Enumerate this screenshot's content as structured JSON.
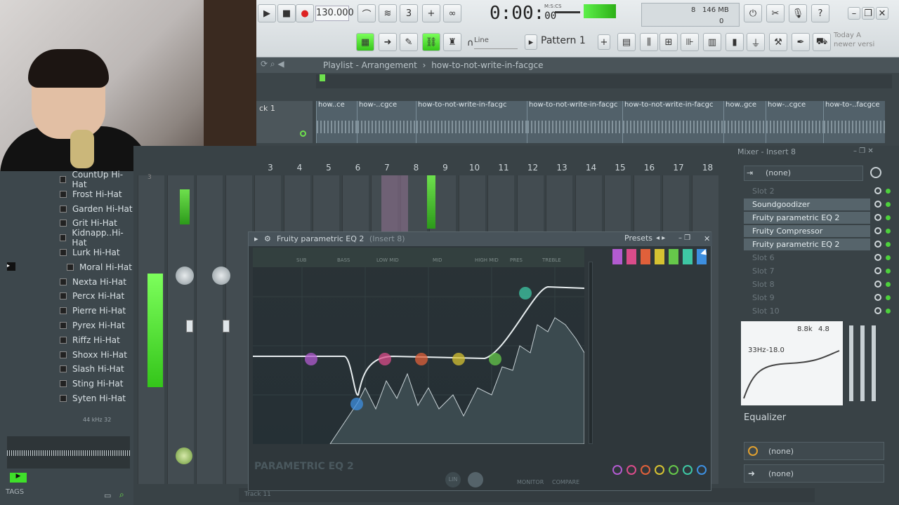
{
  "webcam": {},
  "toolbar": {
    "tempo": "130.000",
    "time_main": "0:00",
    "time_sub": "00",
    "time_unit": "M:S:CS",
    "mem": "146 MB",
    "cpu_num": "8",
    "cpu_zero": "0",
    "line_label": "Line",
    "pattern_label": "Pattern 1",
    "hint_line1": "Today  A",
    "hint_line2": "newer versi"
  },
  "playlist": {
    "title": "Playlist - Arrangement",
    "breadcrumb_sep": "›",
    "project": "how-to-not-write-in-facgce",
    "track_name": "ck 1",
    "clips": [
      {
        "label": "how..ce"
      },
      {
        "label": "how-..cgce"
      },
      {
        "label": "how-to-not-write-in-facgc"
      },
      {
        "label": "how-to-not-write-in-facgc"
      },
      {
        "label": "how-to-not-write-in-facgc"
      },
      {
        "label": "how..gce"
      },
      {
        "label": "how-..cgce"
      },
      {
        "label": "how-to-..facgce"
      }
    ]
  },
  "browser": {
    "items": [
      {
        "label": "CountUp Hi-Hat"
      },
      {
        "label": "Frost Hi-Hat"
      },
      {
        "label": "Garden Hi-Hat"
      },
      {
        "label": "Grit Hi-Hat"
      },
      {
        "label": "Kidnapp..Hi-Hat"
      },
      {
        "label": "Lurk Hi-Hat"
      },
      {
        "label": "Moral Hi-Hat"
      },
      {
        "label": "Nexta Hi-Hat"
      },
      {
        "label": "Percx Hi-Hat"
      },
      {
        "label": "Pierre Hi-Hat"
      },
      {
        "label": "Pyrex Hi-Hat"
      },
      {
        "label": "Riffz Hi-Hat"
      },
      {
        "label": "Shoxx Hi-Hat"
      },
      {
        "label": "Slash Hi-Hat"
      },
      {
        "label": "Sting Hi-Hat"
      },
      {
        "label": "Syten Hi-Hat"
      }
    ],
    "sample_info": "44 kHz 32",
    "tags_label": "TAGS"
  },
  "mixer": {
    "title": "Mixer - Insert 8",
    "insert_numbers": [
      "3",
      "4",
      "5",
      "6",
      "7",
      "8",
      "9",
      "10",
      "11",
      "12",
      "13",
      "14",
      "15",
      "16",
      "17",
      "18"
    ],
    "input_label": "(none)",
    "slots": [
      {
        "label": "Slot 2",
        "active": false
      },
      {
        "label": "Soundgoodizer",
        "active": true
      },
      {
        "label": "Fruity parametric EQ 2",
        "active": true
      },
      {
        "label": "Fruity Compressor",
        "active": true
      },
      {
        "label": "Fruity parametric EQ 2",
        "active": true
      },
      {
        "label": "Slot 6",
        "active": false
      },
      {
        "label": "Slot 7",
        "active": false
      },
      {
        "label": "Slot 8",
        "active": false
      },
      {
        "label": "Slot 9",
        "active": false
      },
      {
        "label": "Slot 10",
        "active": false
      }
    ],
    "eq_freq": "8.8k",
    "eq_res": "4.8",
    "eq_low": "33Hz",
    "eq_low_gain": "-18.0",
    "equalizer_label": "Equalizer",
    "route1": "(none)",
    "route2": "(none)"
  },
  "eq": {
    "title": "Fruity parametric EQ 2",
    "subtitle": "(Insert 8)",
    "presets_label": "Presets",
    "band_labels": [
      "SUB",
      "BASS",
      "LOW MID",
      "MID",
      "HIGH MID",
      "PRES",
      "TREBLE"
    ],
    "brand": "PARAMETRIC EQ",
    "brand_num": "2",
    "monitor_label": "MONITOR",
    "compare_label": "COMPARE",
    "lin_label": "LIN",
    "band_colors": [
      "#b25bd0",
      "#d94c8a",
      "#e0603a",
      "#d6c232",
      "#66c84a",
      "#3ec7a4",
      "#3d8fe0"
    ]
  },
  "footer": {
    "track_label": "Track 11"
  }
}
